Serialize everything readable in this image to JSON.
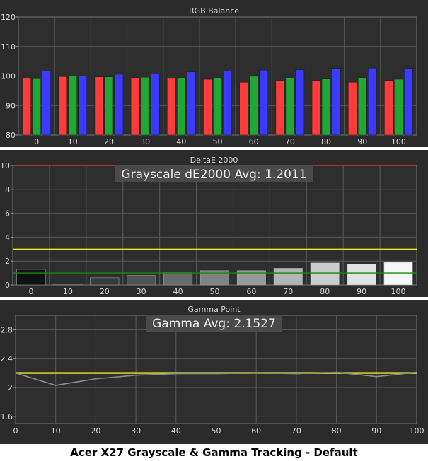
{
  "caption": "Acer X27 Grayscale & Gamma Tracking - Default",
  "colors": {
    "background": "#ffffff",
    "panel": "#2b2b2b",
    "plot": "#2e2e2e",
    "grid": "#5a5a5a",
    "label": "#d8d8d8",
    "red": "#ff3b3b",
    "green": "#21a834",
    "blue": "#3b3bff",
    "yellow": "#e6e620",
    "dark_green": "#138a13",
    "gamma_line": "#8c8c8c",
    "callout": "#4a4a4a"
  },
  "chart_data": [
    {
      "type": "bar",
      "title": "RGB Balance",
      "categories": [
        "0",
        "10",
        "20",
        "30",
        "40",
        "50",
        "60",
        "70",
        "80",
        "90",
        "100"
      ],
      "series": [
        {
          "values": [
            99.2,
            99.8,
            99.7,
            99.4,
            99.2,
            98.9,
            97.9,
            98.5,
            98.5,
            97.9,
            98.5
          ]
        },
        {
          "values": [
            99.1,
            100.0,
            99.7,
            99.6,
            99.4,
            99.4,
            99.9,
            99.3,
            99.0,
            99.4,
            98.9
          ]
        },
        {
          "values": [
            101.7,
            100.0,
            100.6,
            101.0,
            101.4,
            101.7,
            102.0,
            102.1,
            102.6,
            102.7,
            102.6
          ]
        }
      ],
      "ylim": [
        80,
        120
      ],
      "yticks": [
        80,
        90,
        100,
        110,
        120
      ],
      "grid": true
    },
    {
      "type": "bar",
      "title": "DeltaE 2000",
      "callout": "Grayscale dE2000 Avg: 1.2011",
      "categories": [
        "0",
        "10",
        "20",
        "30",
        "40",
        "50",
        "60",
        "70",
        "80",
        "90",
        "100"
      ],
      "values": [
        1.3,
        0.05,
        0.6,
        0.8,
        1.1,
        1.2,
        1.2,
        1.4,
        1.85,
        1.75,
        1.9
      ],
      "bar_colors": [
        "#111111",
        "#1a1a1a",
        "#3a3a3a",
        "#525252",
        "#6a6a6a",
        "#828282",
        "#9a9a9a",
        "#b4b4b4",
        "#cdcdcd",
        "#e2e2e2",
        "#f6f6f6"
      ],
      "reference_lines": [
        {
          "value": 10,
          "color": "#e03030"
        },
        {
          "value": 3,
          "color": "#e6e620"
        },
        {
          "value": 1,
          "color": "#138a13"
        }
      ],
      "ylim": [
        0,
        10
      ],
      "yticks": [
        0,
        2,
        4,
        6,
        8,
        10
      ],
      "grid": true
    },
    {
      "type": "line",
      "title": "Gamma Point",
      "callout": "Gamma Avg: 2.1527",
      "x": [
        0,
        10,
        20,
        30,
        40,
        50,
        60,
        70,
        80,
        90,
        100
      ],
      "series": [
        {
          "values": [
            2.2,
            2.2,
            2.2,
            2.2,
            2.2,
            2.2,
            2.2,
            2.2,
            2.2,
            2.2,
            2.2
          ],
          "color": "#e6e620"
        },
        {
          "values": [
            2.2,
            2.03,
            2.12,
            2.17,
            2.19,
            2.19,
            2.2,
            2.19,
            2.21,
            2.15,
            2.21
          ],
          "color": "#8c8c8c"
        }
      ],
      "xlim": [
        0,
        100
      ],
      "xticks": [
        0,
        10,
        20,
        30,
        40,
        50,
        60,
        70,
        80,
        90,
        100
      ],
      "ylim": [
        1.5,
        3.0
      ],
      "yticks": [
        1.6,
        2.0,
        2.4,
        2.8
      ],
      "grid": true
    }
  ]
}
